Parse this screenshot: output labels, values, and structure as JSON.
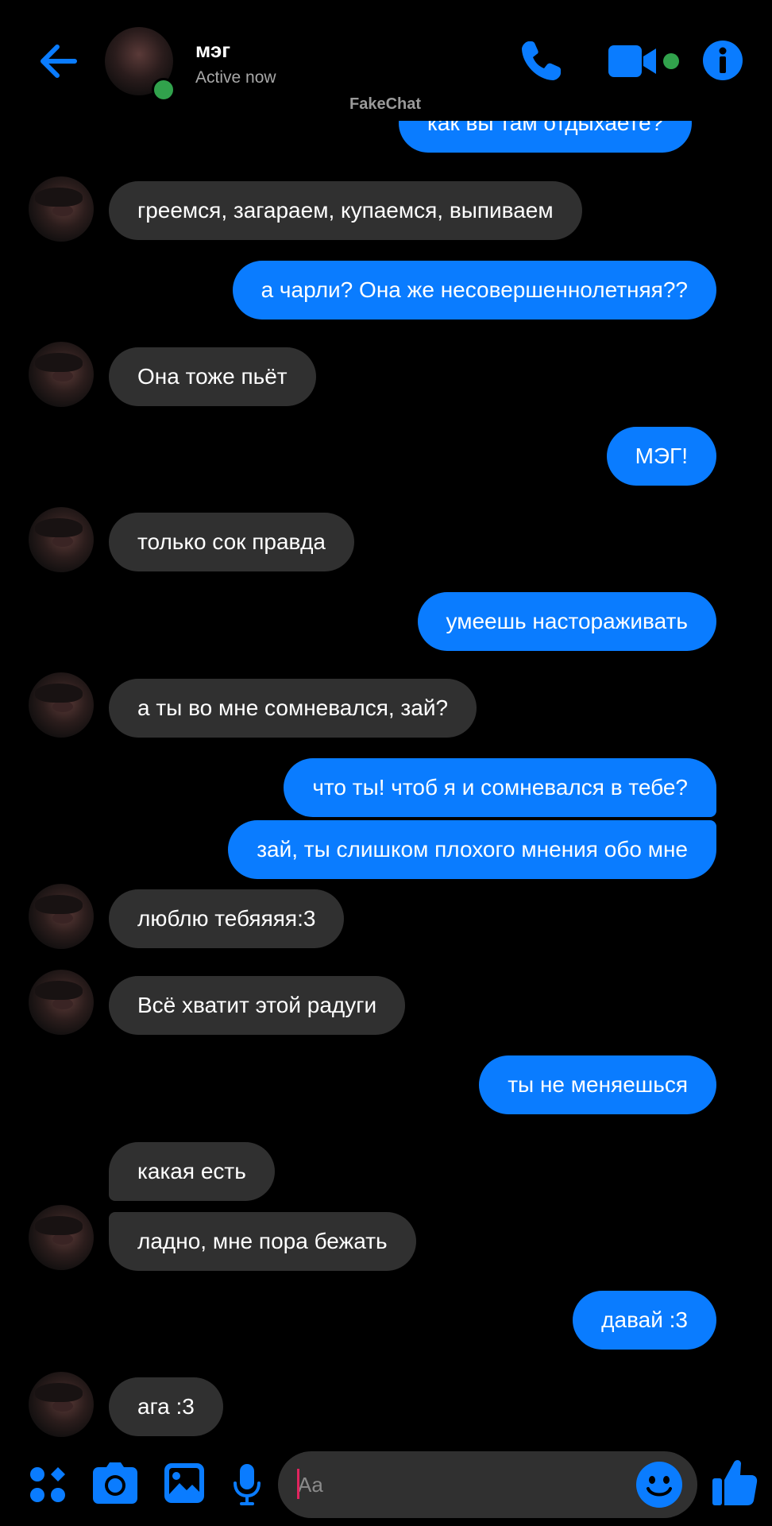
{
  "header": {
    "contact_name": "мэг",
    "status": "Active now",
    "watermark": "FakeChat",
    "icons": {
      "back": "back-arrow-icon",
      "call": "phone-icon",
      "video": "video-camera-icon",
      "info": "info-icon"
    }
  },
  "colors": {
    "accent": "#0a7cff",
    "incoming_bubble": "#303030",
    "online": "#31a24c",
    "background": "#000000"
  },
  "messages": [
    {
      "sender": "me",
      "text": "как вы там отдыхаете?"
    },
    {
      "sender": "contact",
      "text": "греемся, загараем, купаемся, выпиваем",
      "avatar": true
    },
    {
      "sender": "me",
      "text": "а чарли? Она же несовершеннолетняя??"
    },
    {
      "sender": "contact",
      "text": "Она тоже пьёт",
      "avatar": true
    },
    {
      "sender": "me",
      "text": "МЭГ!"
    },
    {
      "sender": "contact",
      "text": "только сок правда",
      "avatar": true
    },
    {
      "sender": "me",
      "text": "умеешь настораживать"
    },
    {
      "sender": "contact",
      "text": "а ты во мне сомневался, зай?",
      "avatar": true
    },
    {
      "sender": "me",
      "text": "что ты! чтоб я и сомневался в тебе?"
    },
    {
      "sender": "me",
      "text": "зай, ты слишком плохого мнения обо мне"
    },
    {
      "sender": "contact",
      "text": "люблю тебяяяя:3",
      "avatar": true
    },
    {
      "sender": "contact",
      "text": "Всё хватит этой радуги",
      "avatar": true
    },
    {
      "sender": "me",
      "text": "ты не меняешься"
    },
    {
      "sender": "contact",
      "text": "какая есть",
      "avatar": false
    },
    {
      "sender": "contact",
      "text": "ладно, мне пора бежать",
      "avatar": true
    },
    {
      "sender": "me",
      "text": "давай :3"
    },
    {
      "sender": "contact",
      "text": "ага :3",
      "avatar": true
    }
  ],
  "composer": {
    "placeholder": "Aa",
    "icons": [
      "apps-grid-icon",
      "camera-icon",
      "gallery-image-icon",
      "microphone-icon",
      "emoji-icon",
      "thumbs-up-icon"
    ]
  }
}
